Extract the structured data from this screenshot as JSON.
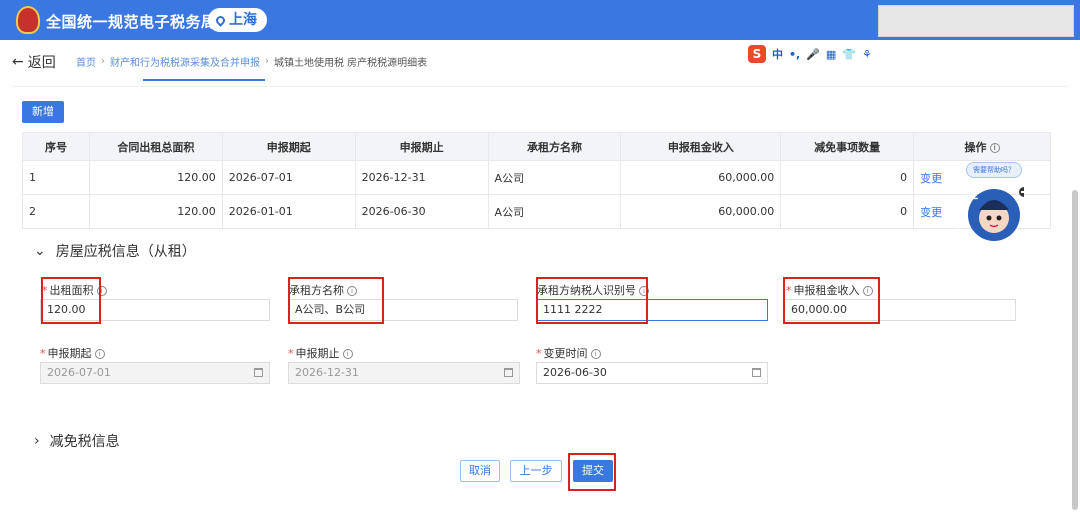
{
  "header": {
    "title": "全国统一规范电子税务局",
    "location": "上海"
  },
  "nav": {
    "back": "返回",
    "crumbs": [
      "首页",
      "财产和行为税税源采集及合并申报",
      "城镇土地使用税 房产税税源明细表"
    ]
  },
  "ime": {
    "brand": "S",
    "items": [
      "中",
      "•,",
      "🎤",
      "▦",
      "👕",
      "⚘"
    ]
  },
  "table": {
    "add_label": "新增",
    "headers": [
      "序号",
      "合同出租总面积",
      "申报期起",
      "申报期止",
      "承租方名称",
      "申报租金收入",
      "减免事项数量",
      "操作"
    ],
    "rows": [
      [
        "1",
        "120.00",
        "2026-07-01",
        "2026-12-31",
        "A公司",
        "60,000.00",
        "0",
        "变更"
      ],
      [
        "2",
        "120.00",
        "2026-01-01",
        "2026-06-30",
        "A公司",
        "60,000.00",
        "0",
        "变更"
      ]
    ]
  },
  "section1": "房屋应税信息（从租）",
  "fields": {
    "area": {
      "label": "出租面积",
      "value": "120.00"
    },
    "lessee_name": {
      "label": "承租方名称",
      "value": "A公司、B公司"
    },
    "lessee_tax_id": {
      "label": "承租方纳税人识别号",
      "value": "1111 2222"
    },
    "rent_income": {
      "label": "申报租金收入",
      "value": "60,000.00"
    },
    "period_start": {
      "label": "申报期起",
      "value": "2026-07-01"
    },
    "period_end": {
      "label": "申报期止",
      "value": "2026-12-31"
    },
    "change_time": {
      "label": "变更时间",
      "value": "2026-06-30"
    }
  },
  "section2": "减免税信息",
  "buttons": {
    "cancel": "取消",
    "prev": "上一步",
    "submit": "提交"
  },
  "mascot": {
    "bubble": "需要帮助吗？",
    "chars": "征纳互动"
  },
  "colors": {
    "brand": "#3a77e0",
    "highlight": "#d9231b"
  }
}
